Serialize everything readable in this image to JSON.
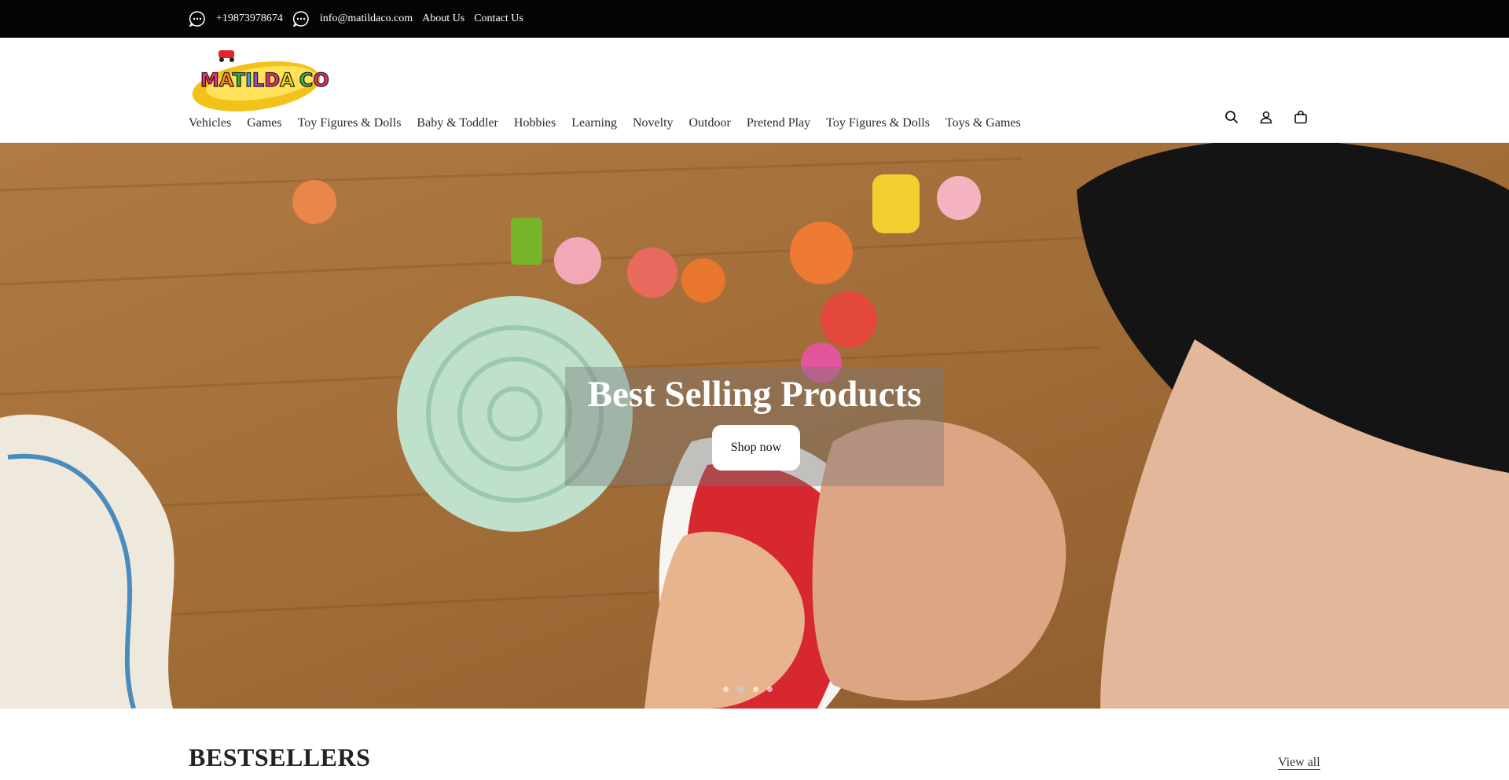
{
  "topbar": {
    "phone": "+19873978674",
    "email": "info@matildaco.com",
    "links": [
      "About Us",
      "Contact Us"
    ],
    "phone_icon": "chat-bubble-icon",
    "email_icon": "chat-bubble-icon"
  },
  "header": {
    "logo_text": "MATILDA CO",
    "icons": [
      "search-icon",
      "account-icon",
      "cart-icon"
    ]
  },
  "nav": {
    "items": [
      "Vehicles",
      "Games",
      "Toy Figures & Dolls",
      "Baby & Toddler",
      "Hobbies",
      "Learning",
      "Novelty",
      "Outdoor",
      "Pretend Play",
      "Toy Figures & Dolls",
      "Toys & Games"
    ]
  },
  "hero": {
    "title": "Best Selling Products",
    "button_label": "Shop now",
    "slide_count": 4,
    "active_slide": 2
  },
  "bestsellers": {
    "title": "BESTSELLERS",
    "view_all": "View all"
  },
  "colors": {
    "topbar_bg": "#050505",
    "hero_wood": "#a8723e"
  }
}
